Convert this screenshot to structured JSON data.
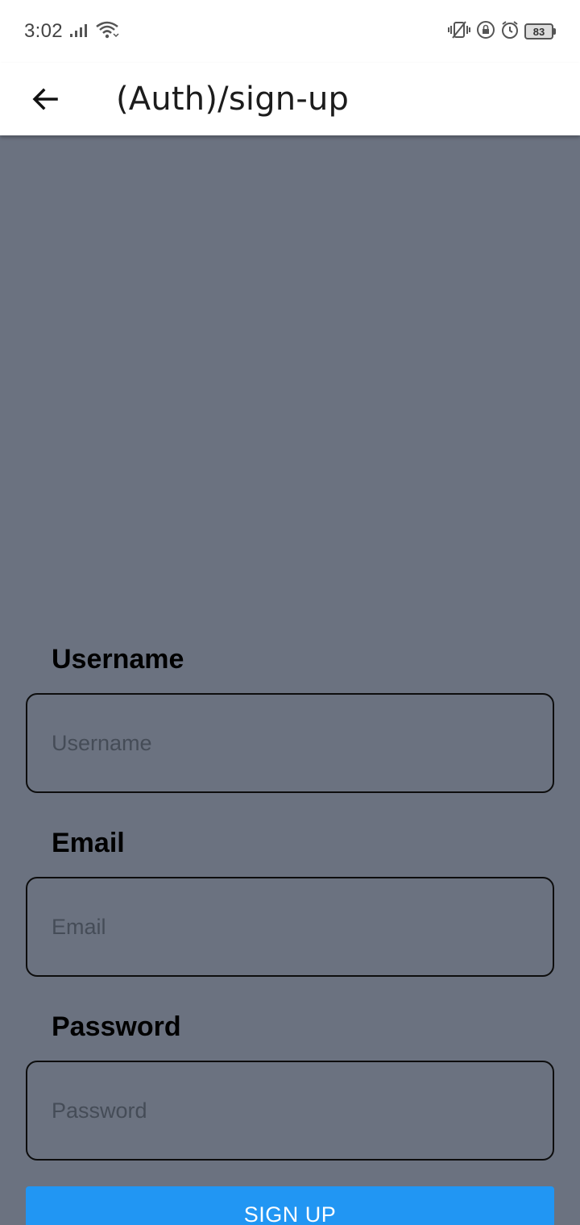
{
  "status_bar": {
    "time": "3:02",
    "battery_level": "83",
    "icons": [
      "signal-icon",
      "wifi-icon",
      "vibrate-icon",
      "rotation-lock-icon",
      "alarm-icon",
      "battery-icon"
    ]
  },
  "app_bar": {
    "title": "(Auth)/sign-up",
    "back_icon": "arrow-left-icon"
  },
  "form": {
    "username": {
      "label": "Username",
      "placeholder": "Username",
      "value": ""
    },
    "email": {
      "label": "Email",
      "placeholder": "Email",
      "value": ""
    },
    "password": {
      "label": "Password",
      "placeholder": "Password",
      "value": ""
    },
    "submit_label": "SIGN UP"
  },
  "colors": {
    "background": "#6b7280",
    "button": "#2196f3",
    "app_bar": "#ffffff"
  }
}
